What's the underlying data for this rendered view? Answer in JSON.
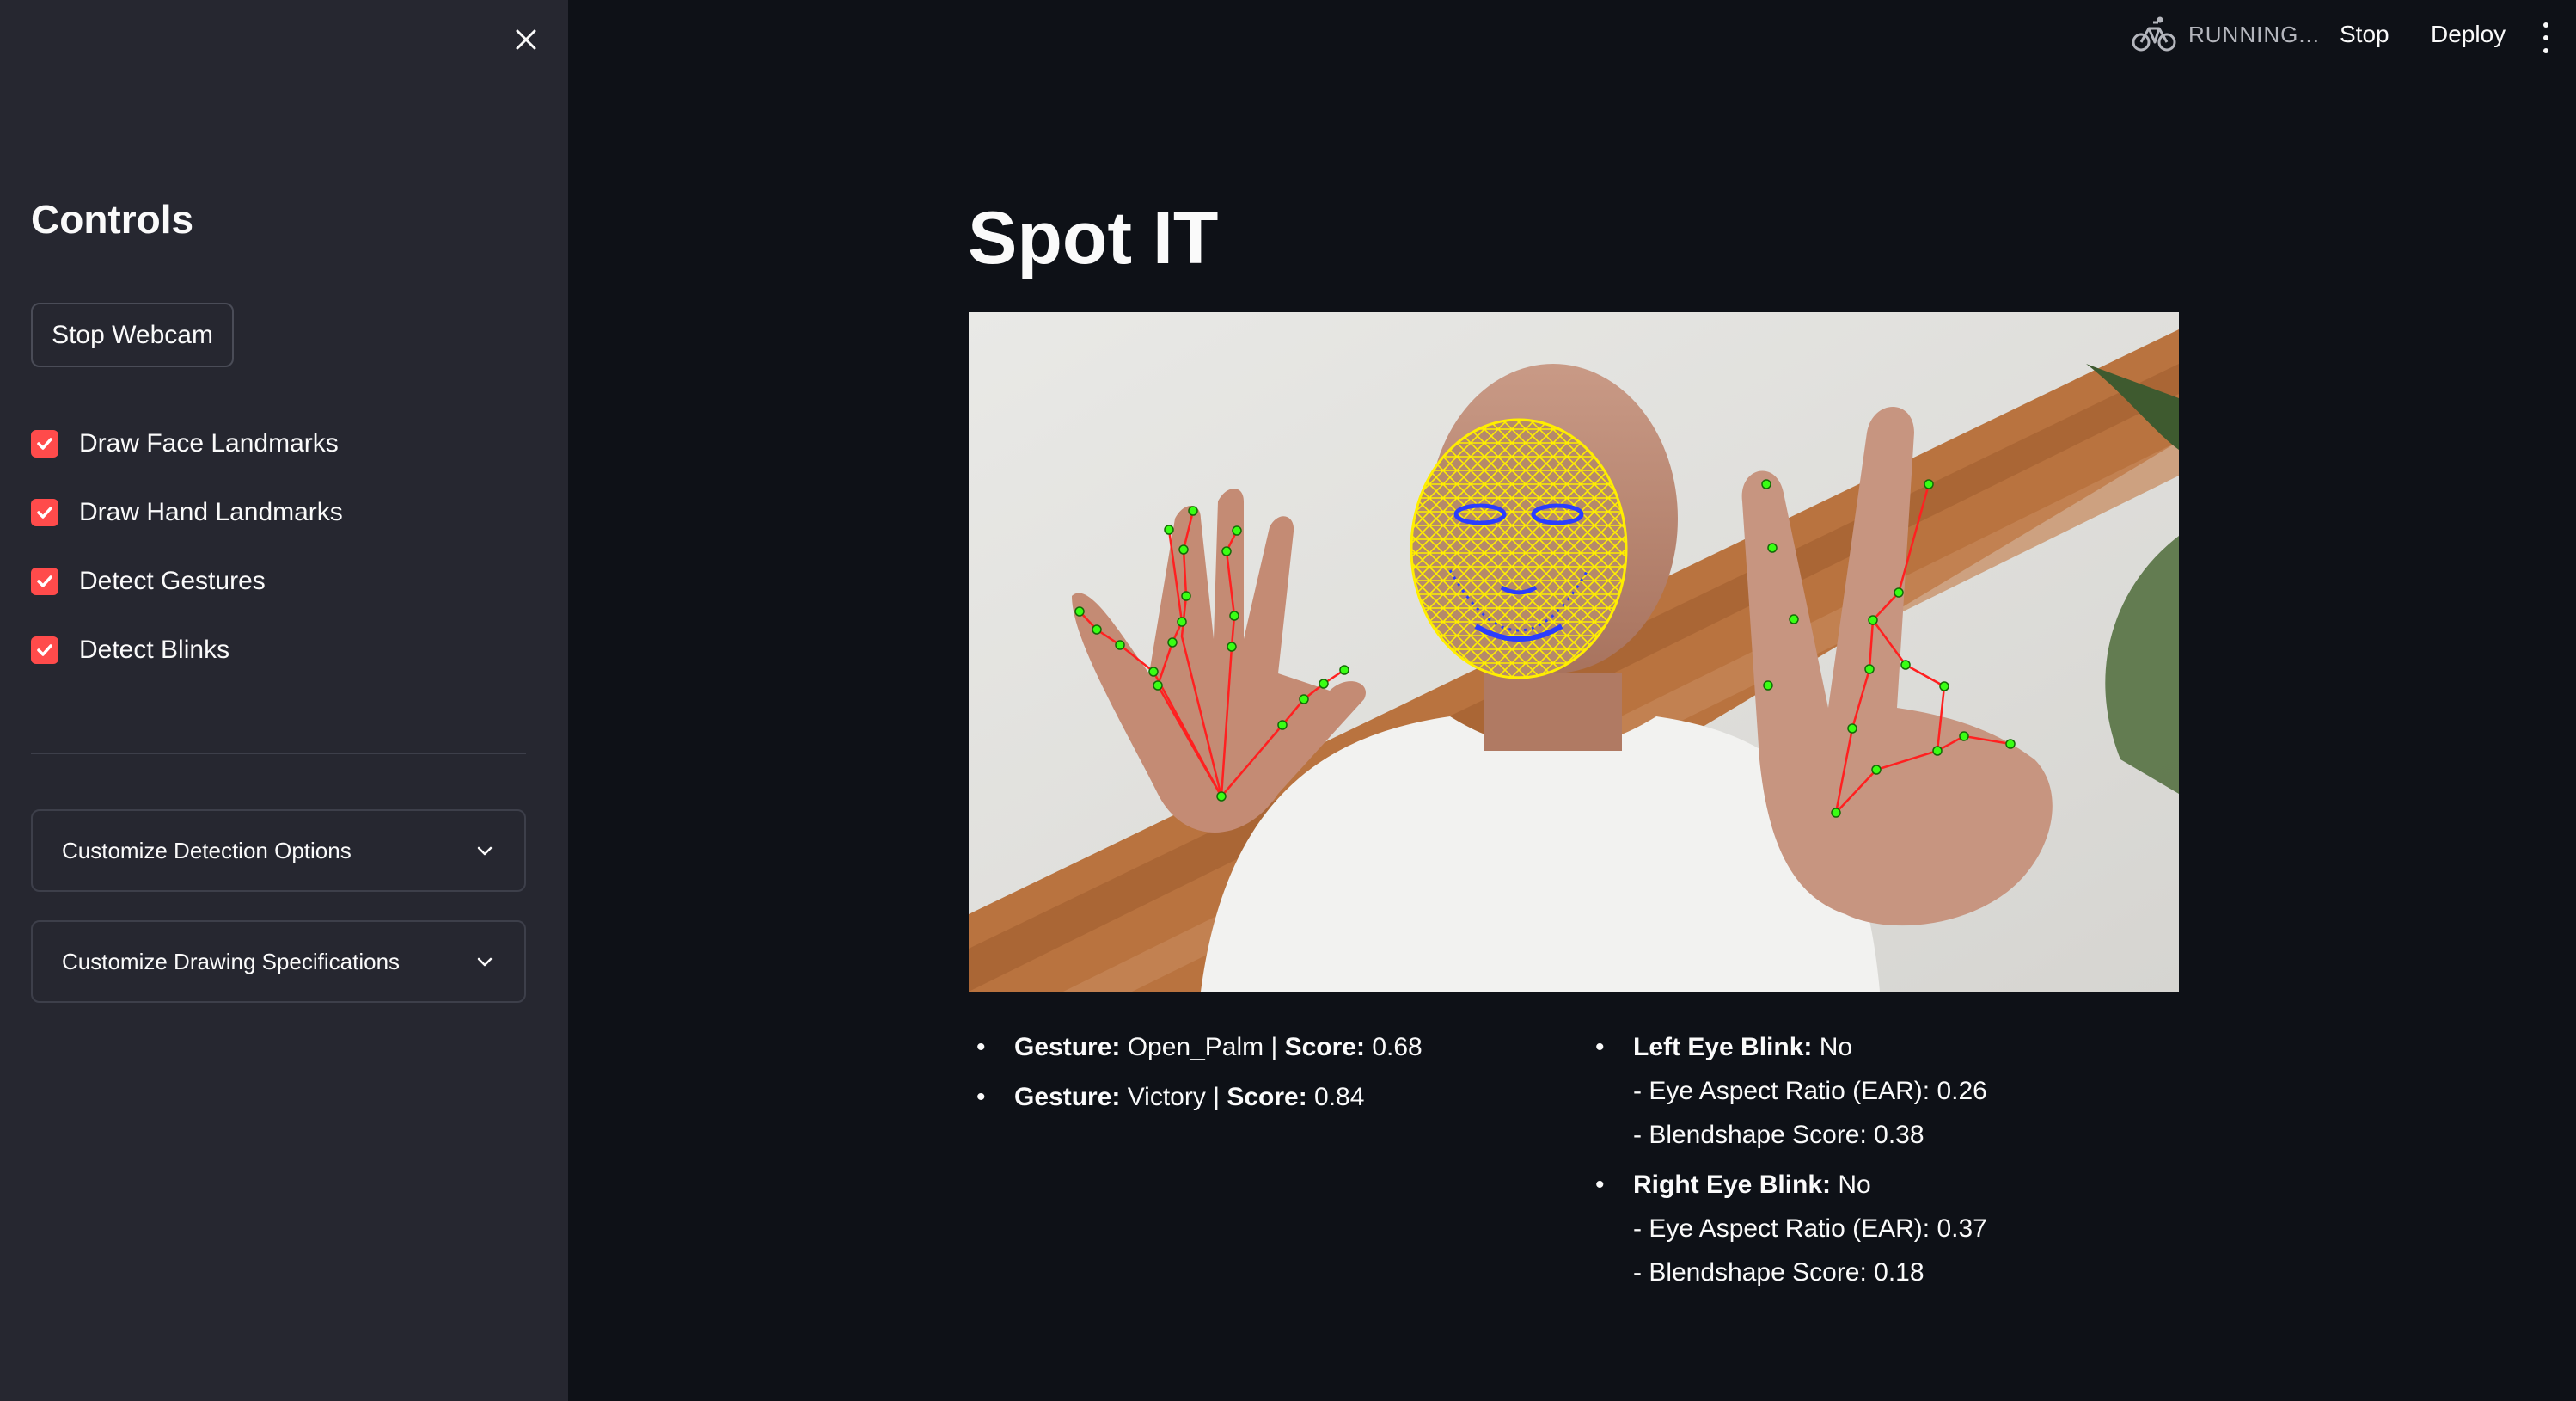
{
  "sidebar": {
    "close_icon": "close-icon",
    "title": "Controls",
    "stop_webcam_label": "Stop Webcam",
    "checkboxes": [
      {
        "label": "Draw Face Landmarks",
        "checked": true
      },
      {
        "label": "Draw Hand Landmarks",
        "checked": true
      },
      {
        "label": "Detect Gestures",
        "checked": true
      },
      {
        "label": "Detect Blinks",
        "checked": true
      }
    ],
    "expanders": [
      {
        "label": "Customize Detection Options",
        "icon": "chevron-down-icon"
      },
      {
        "label": "Customize Drawing Specifications",
        "icon": "chevron-down-icon"
      }
    ]
  },
  "header": {
    "status_icon": "bicycle-icon",
    "status_text": "RUNNING...",
    "stop_label": "Stop",
    "deploy_label": "Deploy",
    "menu_icon": "kebab-menu-icon"
  },
  "main": {
    "title": "Spot IT",
    "gestures": [
      {
        "gesture_label": "Gesture:",
        "gesture_value": " Open_Palm | ",
        "score_label": "Score:",
        "score_value": " 0.68"
      },
      {
        "gesture_label": "Gesture:",
        "gesture_value": " Victory | ",
        "score_label": "Score:",
        "score_value": " 0.84"
      }
    ],
    "blinks": [
      {
        "label": "Left Eye Blink:",
        "value": " No",
        "ear_line": "- Eye Aspect Ratio (EAR): 0.26",
        "blend_line": "- Blendshape Score: 0.38"
      },
      {
        "label": "Right Eye Blink:",
        "value": " No",
        "ear_line": "- Eye Aspect Ratio (EAR): 0.37",
        "blend_line": "- Blendshape Score: 0.18"
      }
    ]
  },
  "colors": {
    "accent": "#ff4b4b",
    "background": "#0e1117",
    "sidebar_bg": "#262730",
    "landmark_point": "#39ff14",
    "landmark_line": "#ff2020",
    "face_mesh": "#ffee00",
    "face_points": "#2a3dff"
  }
}
